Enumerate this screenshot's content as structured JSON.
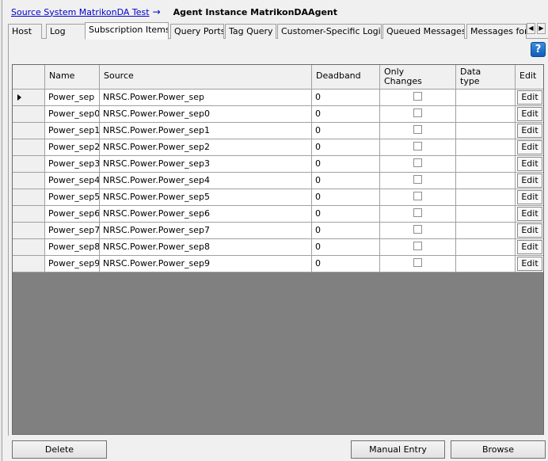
{
  "header": {
    "breadcrumb": "Source System MatrikonDA Test",
    "arrow": "→",
    "title": "Agent Instance MatrikonDAAgent"
  },
  "tabs": [
    {
      "label": "Host"
    },
    {
      "label": "Log"
    },
    {
      "label": "Subscription Items",
      "active": true
    },
    {
      "label": "Query Ports"
    },
    {
      "label": "Tag Query"
    },
    {
      "label": "Customer-Specific Logic"
    },
    {
      "label": "Queued Messages"
    },
    {
      "label": "Messages for"
    }
  ],
  "tab_scroll": {
    "left": "◀",
    "right": "▶"
  },
  "help": {
    "label": "?"
  },
  "grid": {
    "columns": {
      "name": "Name",
      "source": "Source",
      "deadband": "Deadband",
      "only_changes": "Only Changes",
      "data_type": "Data type",
      "edit": "Edit"
    },
    "edit_label": "Edit",
    "rows": [
      {
        "name": "Power_sep",
        "source": "NRSC.Power.Power_sep",
        "deadband": "0",
        "only_changes": false,
        "data_type": "",
        "current": true
      },
      {
        "name": "Power_sep0",
        "source": "NRSC.Power.Power_sep0",
        "deadband": "0",
        "only_changes": false,
        "data_type": ""
      },
      {
        "name": "Power_sep1",
        "source": "NRSC.Power.Power_sep1",
        "deadband": "0",
        "only_changes": false,
        "data_type": ""
      },
      {
        "name": "Power_sep2",
        "source": "NRSC.Power.Power_sep2",
        "deadband": "0",
        "only_changes": false,
        "data_type": ""
      },
      {
        "name": "Power_sep3",
        "source": "NRSC.Power.Power_sep3",
        "deadband": "0",
        "only_changes": false,
        "data_type": ""
      },
      {
        "name": "Power_sep4",
        "source": "NRSC.Power.Power_sep4",
        "deadband": "0",
        "only_changes": false,
        "data_type": ""
      },
      {
        "name": "Power_sep5",
        "source": "NRSC.Power.Power_sep5",
        "deadband": "0",
        "only_changes": false,
        "data_type": ""
      },
      {
        "name": "Power_sep6",
        "source": "NRSC.Power.Power_sep6",
        "deadband": "0",
        "only_changes": false,
        "data_type": ""
      },
      {
        "name": "Power_sep7",
        "source": "NRSC.Power.Power_sep7",
        "deadband": "0",
        "only_changes": false,
        "data_type": ""
      },
      {
        "name": "Power_sep8",
        "source": "NRSC.Power.Power_sep8",
        "deadband": "0",
        "only_changes": false,
        "data_type": ""
      },
      {
        "name": "Power_sep9",
        "source": "NRSC.Power.Power_sep9",
        "deadband": "0",
        "only_changes": false,
        "data_type": ""
      }
    ]
  },
  "buttons": {
    "delete": "Delete",
    "manual_entry": "Manual Entry",
    "browse": "Browse"
  },
  "colors": {
    "link": "#0000cc",
    "grid_background": "#808080",
    "help_icon": "#1a6cc8"
  }
}
